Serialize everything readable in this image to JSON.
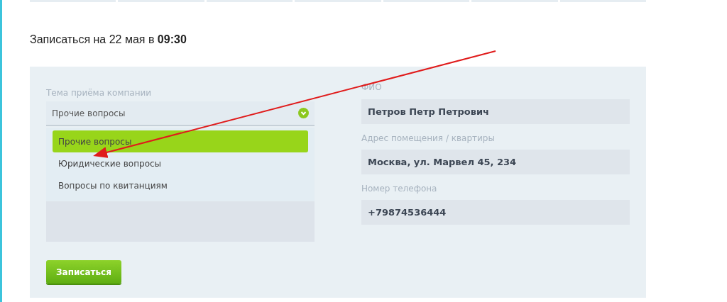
{
  "heading": "Записаться на 22 мая в **09:30**",
  "topic": {
    "label": "Тема приёма компании",
    "value": "Прочие вопросы",
    "expanded": true,
    "options": [
      {
        "label": "Прочие вопросы",
        "selected": true
      },
      {
        "label": "Юридические вопросы",
        "selected": false
      },
      {
        "label": "Вопросы по квитанциям",
        "selected": false
      }
    ]
  },
  "fields": [
    {
      "label": "ФИО",
      "value": "Петров Петр Петрович"
    },
    {
      "label": "Адрес помещения / квартиры",
      "value": "Москва, ул. Марвел 45, 234"
    },
    {
      "label": "Номер телефона",
      "value": "+79874536444"
    }
  ],
  "submit": "Записаться"
}
